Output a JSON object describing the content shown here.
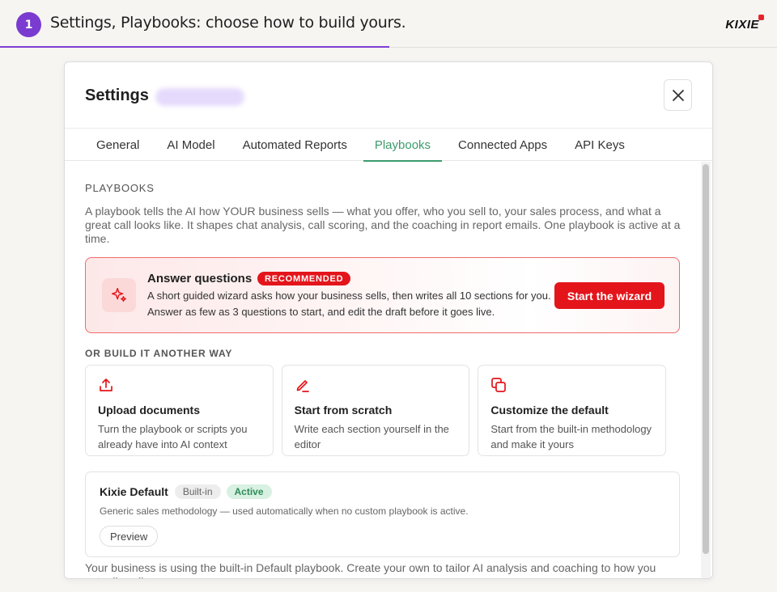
{
  "guide": {
    "step": "1",
    "title": "Settings, Playbooks: choose how to build yours.",
    "logo": "KIXIE"
  },
  "modal": {
    "title": "Settings",
    "tabs": [
      {
        "label": "General"
      },
      {
        "label": "AI Model"
      },
      {
        "label": "Automated Reports"
      },
      {
        "label": "Playbooks"
      },
      {
        "label": "Connected Apps"
      },
      {
        "label": "API Keys"
      }
    ],
    "active_tab": "Playbooks"
  },
  "playbooks": {
    "section_label": "PLAYBOOKS",
    "description": "A playbook tells the AI how YOUR business sells — what you offer, who you sell to, your sales process, and what a great call looks like. It shapes chat analysis, call scoring, and the coaching in report emails. One playbook is active at a time.",
    "wizard": {
      "title": "Answer questions",
      "badge": "RECOMMENDED",
      "line1": "A short guided wizard asks how your business sells, then writes all 10 sections for you.",
      "line2": "Answer as few as 3 questions to start, and edit the draft before it goes live.",
      "button": "Start the wizard"
    },
    "alt_label": "OR BUILD IT ANOTHER WAY",
    "cards": [
      {
        "icon": "upload-icon",
        "title": "Upload documents",
        "desc": "Turn the playbook or scripts you already have into AI context"
      },
      {
        "icon": "pencil-icon",
        "title": "Start from scratch",
        "desc": "Write each section yourself in the editor"
      },
      {
        "icon": "copy-icon",
        "title": "Customize the default",
        "desc": "Start from the built-in methodology and make it yours"
      }
    ],
    "default_playbook": {
      "name": "Kixie Default",
      "builtin_label": "Built-in",
      "active_label": "Active",
      "desc": "Generic sales methodology — used automatically when no custom playbook is active.",
      "preview": "Preview"
    },
    "footer_note": "Your business is using the built-in Default playbook. Create your own to tailor AI analysis and coaching to how you actually sell."
  },
  "colors": {
    "accent_purple": "#7a3bd0",
    "accent_red": "#e3151b",
    "active_green": "#3d9b6d"
  }
}
